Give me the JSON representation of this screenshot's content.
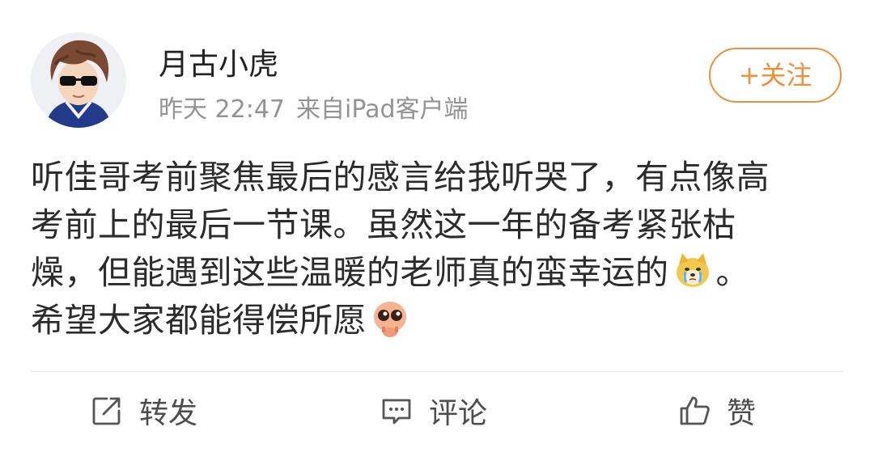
{
  "post": {
    "author": {
      "name": "月古小虎"
    },
    "time": "昨天 22:47",
    "source": "来自iPad客户端",
    "follow_label": "+关注",
    "content": {
      "line1": "听佳哥考前聚焦最后的感言给我听哭了，有点像高",
      "line2": "考前上的最后一节课。虽然这一年的备考紧张枯",
      "line3_before_emoji": "燥，但能遇到这些温暖的老师真的蛮幸运的",
      "line3_after_emoji": "。",
      "line4": "希望大家都能得偿所愿",
      "emojis": [
        "crying-doge-emoji",
        "pleading-emoji"
      ]
    },
    "actions": {
      "repost_label": "转发",
      "comment_label": "评论",
      "like_label": "赞"
    },
    "colors": {
      "accent": "#ef8f3c",
      "meta_text": "#939393",
      "body_text": "#2b2b2b",
      "divider": "#e6e6e6"
    }
  }
}
